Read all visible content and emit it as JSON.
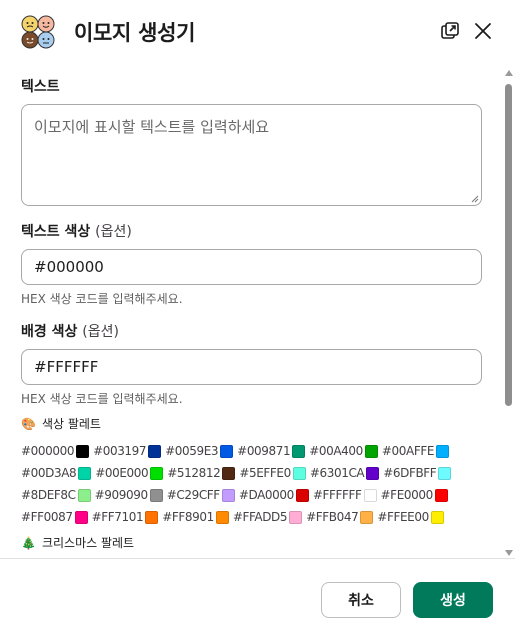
{
  "header": {
    "title": "이모지 생성기",
    "icons": {
      "logo": "emoji-faces-logo",
      "popout": "popout-icon",
      "close": "close-icon"
    }
  },
  "text_field": {
    "label": "텍스트",
    "placeholder": "이모지에 표시할 텍스트를 입력하세요"
  },
  "text_color": {
    "label": "텍스트 색상",
    "optional": "(옵션)",
    "value": "#000000",
    "hint": "HEX 색상 코드를 입력해주세요."
  },
  "bg_color": {
    "label": "배경 색상",
    "optional": "(옵션)",
    "value": "#FFFFFF",
    "hint": "HEX 색상 코드를 입력해주세요."
  },
  "palette": {
    "title": "색상 팔레트",
    "emoji": "🎨",
    "rows": [
      [
        "#000000",
        "#003197",
        "#0059E3",
        "#009871",
        "#00A400",
        "#00AFFE"
      ],
      [
        "#00D3A8",
        "#00E000",
        "#512812",
        "#5EFFE0",
        "#6301CA",
        "#6DFBFF"
      ],
      [
        "#8DEF8C",
        "#909090",
        "#C29CFF",
        "#DA0000",
        "#FFFFFF",
        "#FE0000"
      ],
      [
        "#FF0087",
        "#FF7101",
        "#FF8901",
        "#FFADD5",
        "#FFB047",
        "#FFEE00"
      ]
    ]
  },
  "christmas_palette": {
    "title": "크리스마스 팔레트",
    "emoji": "🎄"
  },
  "footer": {
    "cancel_label": "취소",
    "create_label": "생성"
  },
  "colors": {
    "primary_button": "#007a5a",
    "border": "#a8a8a8"
  }
}
